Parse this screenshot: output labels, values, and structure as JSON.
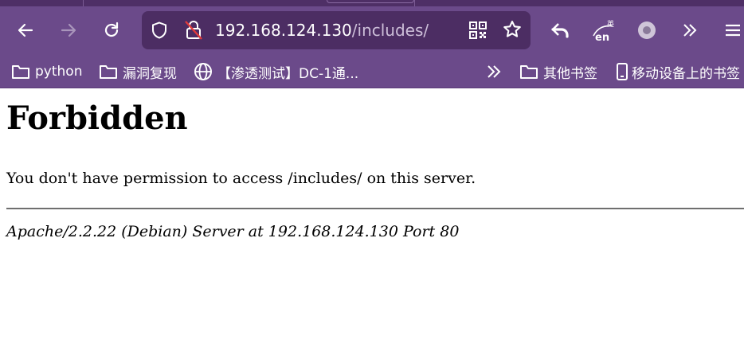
{
  "browser": {
    "url_host": "192.168.124.130",
    "url_path": "/includes/",
    "toolbar": {
      "back_icon": "arrow-left-icon",
      "forward_icon": "arrow-right-icon",
      "reload_icon": "reload-icon",
      "translate_icon_text": "en",
      "translate_icon_subtext": "英"
    },
    "bookmarks": [
      {
        "label": "python",
        "icon": "folder-icon"
      },
      {
        "label": "漏洞复现",
        "icon": "folder-icon"
      },
      {
        "label": "【渗透测试】DC-1通...",
        "icon": "globe-icon"
      }
    ],
    "bookmarks_right": [
      {
        "label": "其他书签",
        "icon": "folder-icon"
      },
      {
        "label": "移动设备上的书签",
        "icon": "mobile-icon"
      }
    ],
    "colors": {
      "chrome": "#6b4a8a",
      "urlbar": "#4c2d63",
      "tabstrip": "#4e2f66"
    }
  },
  "page": {
    "heading": "Forbidden",
    "message": "You don't have permission to access /includes/ on this server.",
    "server_signature": "Apache/2.2.22 (Debian) Server at 192.168.124.130 Port 80"
  }
}
